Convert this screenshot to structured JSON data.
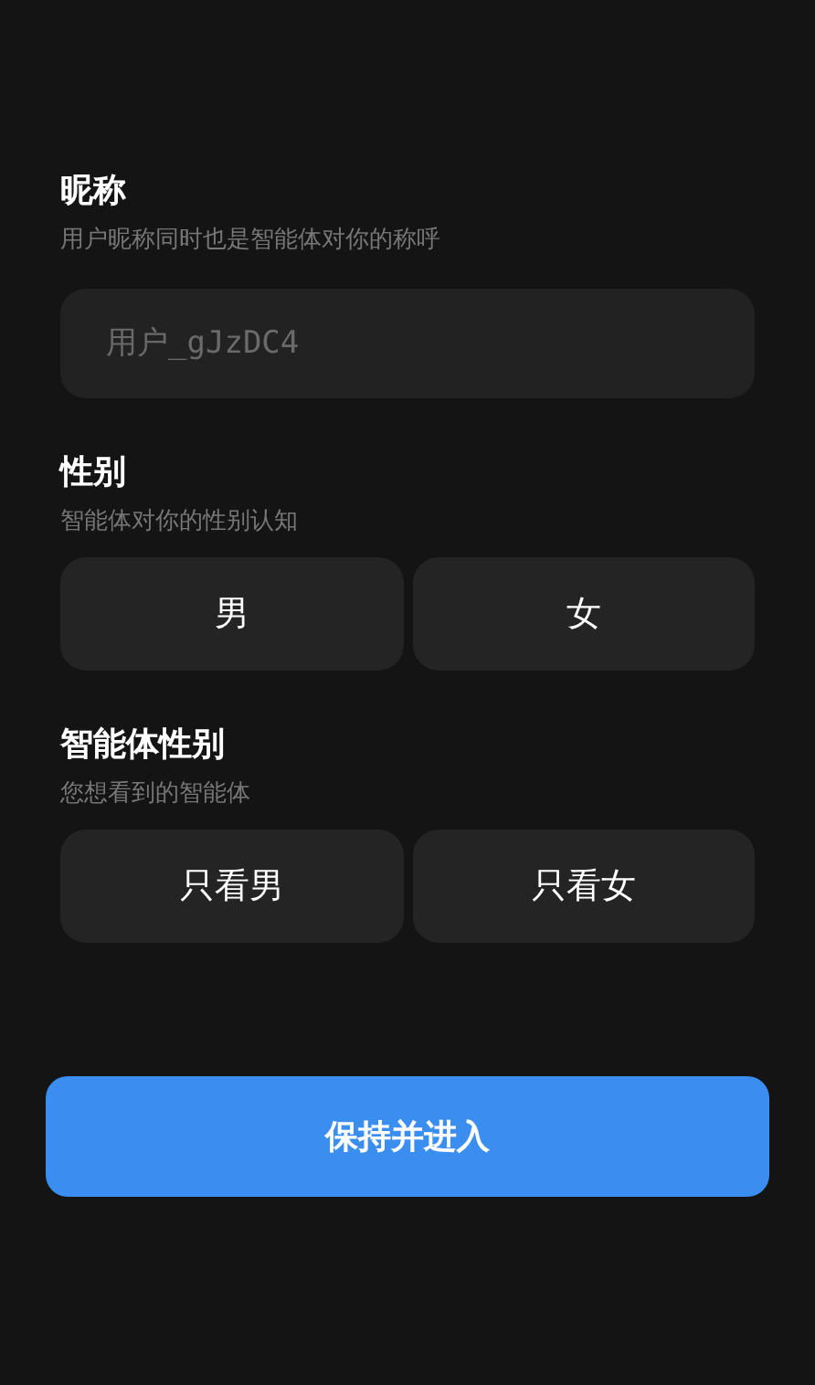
{
  "sections": [
    {
      "title": "昵称",
      "subtitle": "用户昵称同时也是智能体对你的称呼",
      "kind": "field",
      "placeholder": "用户_gJzDC4"
    },
    {
      "title": "性别",
      "subtitle": "智能体对你的性别认知",
      "kind": "choice",
      "options": [
        {
          "label": "男",
          "selected": false
        },
        {
          "label": "女",
          "selected": false
        }
      ]
    },
    {
      "title": "智能体性别",
      "subtitle": "您想看到的智能体",
      "kind": "choice",
      "options": [
        {
          "label": "只看男",
          "selected": false
        },
        {
          "label": "只看女",
          "selected": false
        }
      ]
    }
  ],
  "submit": {
    "label": "保持并进入"
  }
}
